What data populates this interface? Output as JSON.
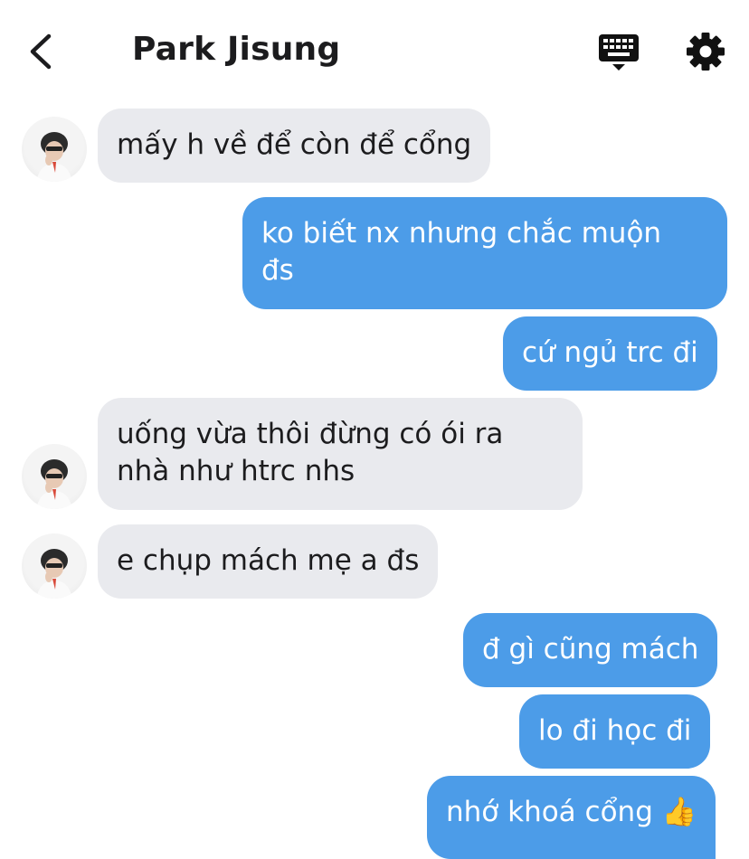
{
  "header": {
    "title": "Park Jisung",
    "back_icon": "chevron-left-icon",
    "keyboard_icon": "keyboard-icon",
    "settings_icon": "gear-icon"
  },
  "messages": [
    {
      "sender": "them",
      "text": "mấy h về để còn để cổng"
    },
    {
      "sender": "me",
      "text": "ko biết nx nhưng chắc muộn\nđs"
    },
    {
      "sender": "me",
      "text": "cứ ngủ trc đi"
    },
    {
      "sender": "them",
      "text": "uống vừa thôi đừng có ói ra\nnhà như htrc nhs"
    },
    {
      "sender": "them",
      "text": "e chụp mách mẹ a đs"
    },
    {
      "sender": "me",
      "text": "đ gì cũng mách"
    },
    {
      "sender": "me",
      "text": "lo đi học đi"
    },
    {
      "sender": "me",
      "text": "nhớ khoá cổng 👍"
    }
  ],
  "colors": {
    "incoming_bubble": "#e9eaee",
    "outgoing_bubble": "#4c9ce8",
    "title": "#1c1c1e"
  }
}
